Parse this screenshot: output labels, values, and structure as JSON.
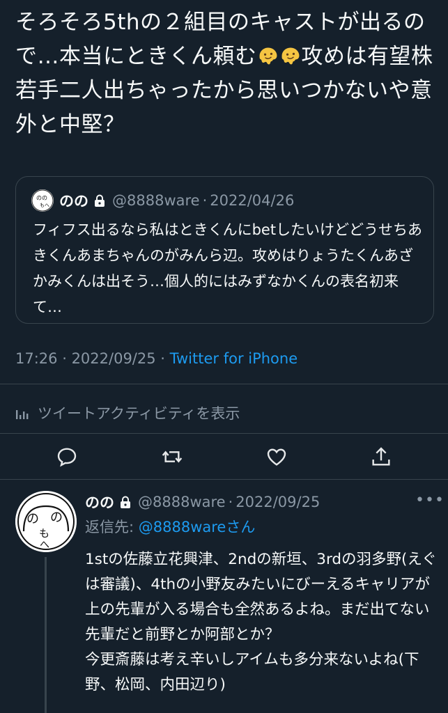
{
  "tweet": {
    "text_part1": "そろそろ5thの２組目のキャストが出るので…本当にときくん頼む",
    "emoji_name": "melting-face-emoji",
    "text_part2": "攻めは有望株若手二人出ちゃったから思いつかないや意外と中堅？"
  },
  "quote": {
    "name": "のの",
    "handle": "@8888ware",
    "dot": "·",
    "date": "2022/04/26",
    "text": "フィフス出るなら私はときくんにbetしたいけどどうせちあきくんあまちゃんのがみんら辺。攻めはりょうたくんあざかみくんは出そう…個人的にはみずなかくんの表名初来て…"
  },
  "meta": {
    "time": "17:26",
    "sep": " · ",
    "date": "2022/09/25",
    "sep2": " · ",
    "source": "Twitter for iPhone"
  },
  "activity_label": "ツイートアクティビティを表示",
  "actions": [
    "reply-icon",
    "retweet-icon",
    "like-icon",
    "share-icon"
  ],
  "reply": {
    "name": "のの",
    "handle": "@8888ware",
    "dot": "·",
    "date": "2022/09/25",
    "more": "•••",
    "reply_to_label": "返信先: ",
    "reply_to_mention": "@8888ware",
    "reply_to_suffix": "さん",
    "text": "1stの佐藤立花興津、2ndの新垣、3rdの羽多野(えぐは審議)、4thの小野友みたいにびーえるキャリアが上の先輩が入る場合も全然あるよね。まだ出てない先輩だと前野とか阿部とか？\n今更斎藤は考え辛いしアイムも多分来ないよね(下野、松岡、内田辺り)"
  },
  "colors": {
    "background": "#15202b",
    "text": "#f7f9f9",
    "secondary": "#8b98a5",
    "link": "#1d9bf0",
    "border": "#38444d"
  }
}
